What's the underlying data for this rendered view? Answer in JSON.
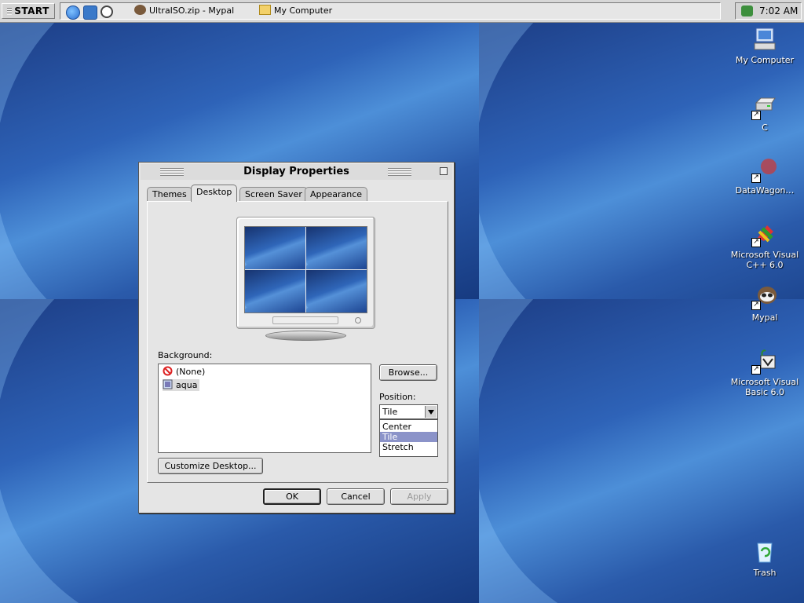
{
  "taskbar": {
    "start_label": "START",
    "quick_launch": [
      {
        "name": "internet-explorer-icon",
        "color": "#2b6fd1"
      },
      {
        "name": "outlook-express-icon",
        "color": "#3a79c9"
      },
      {
        "name": "media-player-icon",
        "color": "#444444"
      }
    ],
    "tasks": [
      {
        "label": "UltraISO.zip - Mypal",
        "icon": "mypal-icon"
      },
      {
        "label": "My Computer",
        "icon": "folder-icon"
      }
    ],
    "clock": "7:02 AM"
  },
  "desktop_icons": [
    {
      "label": "My Computer",
      "icon": "my-computer-icon"
    },
    {
      "label": "C",
      "icon": "drive-icon"
    },
    {
      "label": "DataWagon…",
      "icon": "datawagon-icon"
    },
    {
      "label": "Microsoft Visual C++ 6.0",
      "icon": "visual-cpp-icon"
    },
    {
      "label": "Mypal",
      "icon": "mypal-icon"
    },
    {
      "label": "Microsoft Visual Basic 6.0",
      "icon": "visual-basic-icon"
    },
    {
      "label": "Trash",
      "icon": "trash-icon"
    }
  ],
  "dialog": {
    "title": "Display Properties",
    "tabs": [
      "Themes",
      "Desktop",
      "Screen Saver",
      "Appearance"
    ],
    "active_tab": "Desktop",
    "background_label": "Background:",
    "background_items": [
      "(None)",
      "aqua"
    ],
    "selected_background": "aqua",
    "browse_label": "Browse...",
    "position_label": "Position:",
    "position_value": "Tile",
    "position_options": [
      "Center",
      "Tile",
      "Stretch"
    ],
    "customize_label": "Customize Desktop...",
    "ok_label": "OK",
    "cancel_label": "Cancel",
    "apply_label": "Apply"
  },
  "colors": {
    "selection_highlight": "#8b93c9",
    "wallpaper_blue": "#2e63b8"
  }
}
